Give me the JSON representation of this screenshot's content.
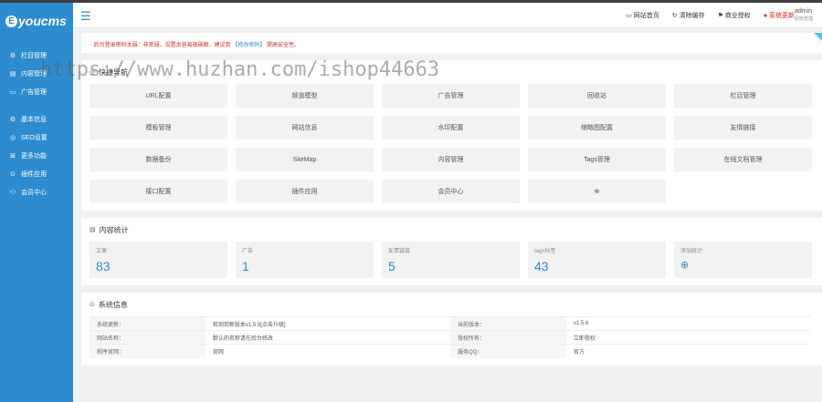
{
  "brand": {
    "logo_letter": "E",
    "logo_text": "youcms"
  },
  "sidebar": {
    "items": [
      {
        "icon": "⚙",
        "label": "栏目管理"
      },
      {
        "icon": "▤",
        "label": "内容管理"
      },
      {
        "icon": "▭",
        "label": "广告管理"
      },
      {
        "icon": "⚙",
        "label": "基本信息"
      },
      {
        "icon": "◎",
        "label": "SEO设置"
      },
      {
        "icon": "⊞",
        "label": "更多功能"
      },
      {
        "icon": "⊙",
        "label": "插件应用"
      },
      {
        "icon": "⚇",
        "label": "会员中心"
      }
    ]
  },
  "header": {
    "links": [
      "网站首页",
      "清除缓存",
      "商业授权",
      "系统更新"
    ],
    "user": "admin",
    "role": "超级管理"
  },
  "notice": {
    "text": "· 后台登录密码太弱：非常弱，设置太容易被破解，建议到",
    "link": "【修改密码】",
    "suffix": "提高安全性。"
  },
  "watermark": "https://www.huzhan.com/ishop44663",
  "quick_nav": {
    "title": "快捷导航",
    "items": [
      "URL配置",
      "频道模型",
      "广告管理",
      "回收站",
      "栏目管理",
      "模板管理",
      "网站信息",
      "水印配置",
      "缩略图配置",
      "友情链接",
      "数据备份",
      "SiteMap",
      "内容管理",
      "Tags管理",
      "在线文档管理",
      "接口配置",
      "插件应用",
      "会员中心",
      "⊕"
    ]
  },
  "content_stats": {
    "title": "内容统计",
    "items": [
      {
        "label": "文章",
        "value": "83"
      },
      {
        "label": "广告",
        "value": "1"
      },
      {
        "label": "友情链接",
        "value": "5"
      },
      {
        "label": "tags标签",
        "value": "43"
      },
      {
        "label": "添加统计",
        "value": "⊕"
      }
    ]
  },
  "system_info": {
    "title": "系统信息",
    "rows": [
      {
        "k1": "系统更新：",
        "v1": "检测到新版本v1.5.8[点击升级]",
        "k2": "当前版本：",
        "v2": "v1.5.6"
      },
      {
        "k1": "网站名称：",
        "v1": "默认的名称请在后台修改",
        "k2": "授权所有：",
        "v2": "立即授权"
      },
      {
        "k1": "程序官网：",
        "v1": "官网",
        "k2": "服务QQ：",
        "v2": "官方"
      }
    ]
  },
  "colors": {
    "sidebar": "#2d8ccf",
    "accent": "#2d8ccf",
    "warning": "#d9281f"
  }
}
